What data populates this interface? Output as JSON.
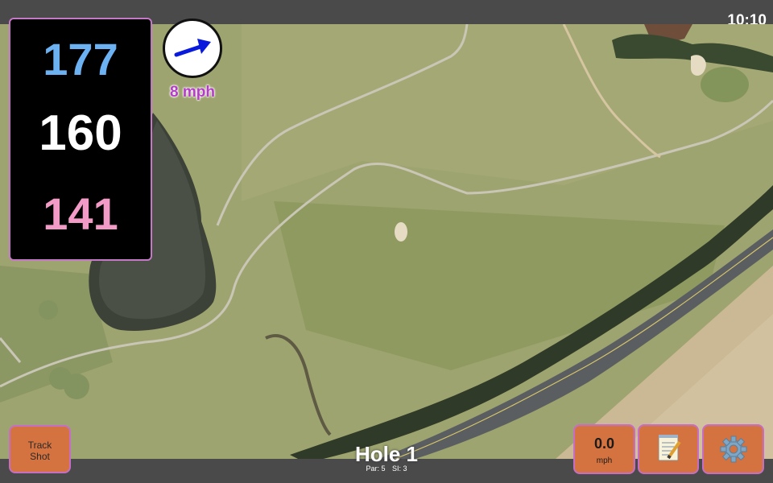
{
  "status_bar": {
    "time": "10:10"
  },
  "distances": {
    "back": "177",
    "middle": "160",
    "front": "141"
  },
  "wind": {
    "speed": "8 mph",
    "icon": "wind-arrow-icon"
  },
  "track_shot_button": {
    "line1": "Track",
    "line2": "Shot"
  },
  "speed_button": {
    "value": "0.0",
    "unit": "mph"
  },
  "notes_button": {
    "icon": "notepad-icon"
  },
  "settings_button": {
    "icon": "gear-icon"
  },
  "hole": {
    "title": "Hole 1",
    "par": "Par: 5",
    "si": "SI: 3"
  },
  "colors": {
    "back_distance": "#6cb2f2",
    "middle_distance": "#ffffff",
    "front_distance": "#f29bc6",
    "button_fill": "#d4733f",
    "accent_border": "#c66ec4",
    "wind_text": "#b43cc8"
  }
}
